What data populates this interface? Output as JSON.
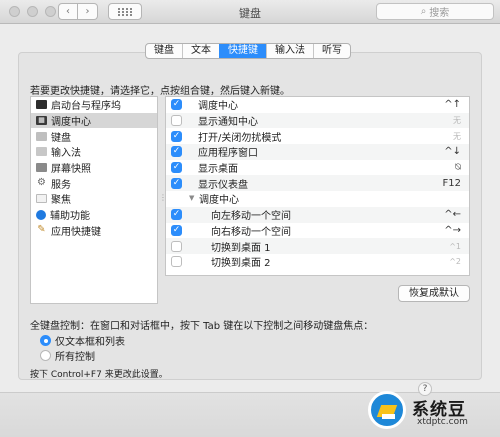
{
  "window": {
    "title": "键盘"
  },
  "toolbar": {
    "back": "‹",
    "forward": "›",
    "search_placeholder": "搜索"
  },
  "tabs": [
    {
      "label": "键盘",
      "active": false
    },
    {
      "label": "文本",
      "active": false
    },
    {
      "label": "快捷键",
      "active": true
    },
    {
      "label": "输入法",
      "active": false
    },
    {
      "label": "听写",
      "active": false
    }
  ],
  "instruction": "若要更改快捷键，请选择它，点按组合键，然后键入新键。",
  "categories": [
    {
      "label": "启动台与程序坞",
      "icon": "launchpad-dock-icon",
      "selected": false
    },
    {
      "label": "调度中心",
      "icon": "mission-control-icon",
      "selected": true
    },
    {
      "label": "键盘",
      "icon": "keyboard-icon",
      "selected": false
    },
    {
      "label": "输入法",
      "icon": "input-source-icon",
      "selected": false
    },
    {
      "label": "屏幕快照",
      "icon": "screenshot-icon",
      "selected": false
    },
    {
      "label": "服务",
      "icon": "services-gear-icon",
      "selected": false
    },
    {
      "label": "聚焦",
      "icon": "spotlight-icon",
      "selected": false
    },
    {
      "label": "辅助功能",
      "icon": "accessibility-icon",
      "selected": false
    },
    {
      "label": "应用快捷键",
      "icon": "app-shortcuts-icon",
      "selected": false
    }
  ],
  "shortcuts": [
    {
      "label": "调度中心",
      "checked": true,
      "shortcut": "^↑",
      "dim": false,
      "indent": false
    },
    {
      "label": "显示通知中心",
      "checked": false,
      "shortcut": "无",
      "dim": true,
      "indent": false
    },
    {
      "label": "打开/关闭勿扰模式",
      "checked": true,
      "shortcut": "无",
      "dim": true,
      "indent": false
    },
    {
      "label": "应用程序窗口",
      "checked": true,
      "shortcut": "^↓",
      "dim": false,
      "indent": false
    },
    {
      "label": "显示桌面",
      "checked": true,
      "shortcut": "⍉",
      "dim": false,
      "indent": false
    },
    {
      "label": "显示仪表盘",
      "checked": true,
      "shortcut": "F12",
      "dim": false,
      "indent": false
    },
    {
      "label": "调度中心",
      "checked": null,
      "shortcut": "",
      "dim": false,
      "indent": false,
      "group": true
    },
    {
      "label": "向左移动一个空间",
      "checked": true,
      "shortcut": "^←",
      "dim": false,
      "indent": true
    },
    {
      "label": "向右移动一个空间",
      "checked": true,
      "shortcut": "^→",
      "dim": false,
      "indent": true
    },
    {
      "label": "切换到桌面 1",
      "checked": false,
      "shortcut": "^1",
      "dim": true,
      "indent": true
    },
    {
      "label": "切换到桌面 2",
      "checked": false,
      "shortcut": "^2",
      "dim": true,
      "indent": true
    }
  ],
  "restore_button": "恢复成默认",
  "keyboard_control": {
    "label": "全键盘控制：在窗口和对话框中，按下 Tab 键在以下控制之间移动键盘焦点：",
    "options": [
      {
        "label": "仅文本框和列表",
        "selected": true
      },
      {
        "label": "所有控制",
        "selected": false
      }
    ]
  },
  "hint": "按下 Control+F7 来更改此设置。",
  "watermark": {
    "title": "系统豆",
    "url": "xtdptc.com"
  },
  "colors": {
    "accent": "#2c8dfb",
    "selection": "#d6d6d6"
  }
}
